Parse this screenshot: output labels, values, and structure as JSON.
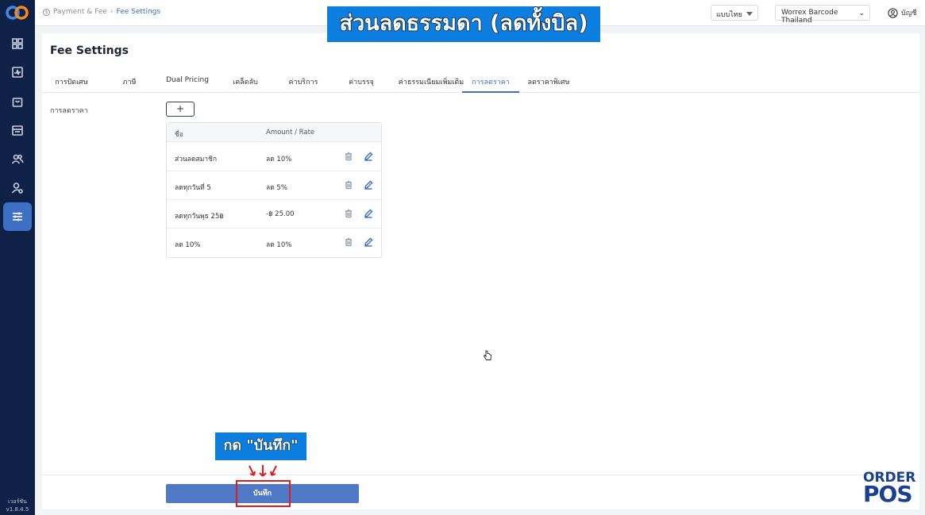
{
  "sidebar": {
    "items": [
      {
        "icon": "grid-icon"
      },
      {
        "icon": "activity-icon"
      },
      {
        "icon": "bag-icon"
      },
      {
        "icon": "store-icon"
      },
      {
        "icon": "users-icon"
      },
      {
        "icon": "user-settings-icon"
      },
      {
        "icon": "sliders-icon",
        "active": true
      }
    ],
    "version_label": "เวอร์ชัน",
    "version_number": "v1.8.4.5"
  },
  "header": {
    "breadcrumb_section": "Payment & Fee",
    "breadcrumb_current": "Fee Settings",
    "language": "แบบไทย",
    "store": "Worrex Barcode Thailand",
    "account": "บัญชี"
  },
  "page": {
    "title": "Fee Settings",
    "tabs": [
      {
        "label": "การปัดเศษ"
      },
      {
        "label": "ภาษี"
      },
      {
        "label": "Dual Pricing"
      },
      {
        "label": "เคล็ดลับ"
      },
      {
        "label": "ค่าบริการ"
      },
      {
        "label": "ค่าบรรจุ"
      },
      {
        "label": "ค่าธรรมเนียมเพิ่มเติม"
      },
      {
        "label": "การลดราคา",
        "active": true
      },
      {
        "label": "ลดราคาพิเศษ"
      }
    ],
    "field_label": "การลดราคา",
    "add_button": "+",
    "table": {
      "headers": [
        "ชื่อ",
        "Amount / Rate"
      ],
      "rows": [
        {
          "name": "ส่วนลดสมาชิก",
          "amount": "ลด 10%"
        },
        {
          "name": "ลดทุกวันที่ 5",
          "amount": "ลด 5%"
        },
        {
          "name": "ลดทุกวันพุธ 25฿",
          "amount": "-฿ 25.00"
        },
        {
          "name": "ลด 10%",
          "amount": "ลด 10%"
        }
      ]
    },
    "save_button": "บันทึก"
  },
  "overlays": {
    "title_caption": "ส่วนลดธรรมดา (ลดทั้งบิล)",
    "press_caption": "กด \"บันทึก\"",
    "brand_top": "ORDER",
    "brand_bottom": "POS"
  },
  "colors": {
    "sidebar": "#0f2147",
    "accent": "#3d6fc4",
    "save_button": "#4f79c4",
    "caption_bg": "#0b7ee0",
    "highlight": "#e11a1a"
  }
}
